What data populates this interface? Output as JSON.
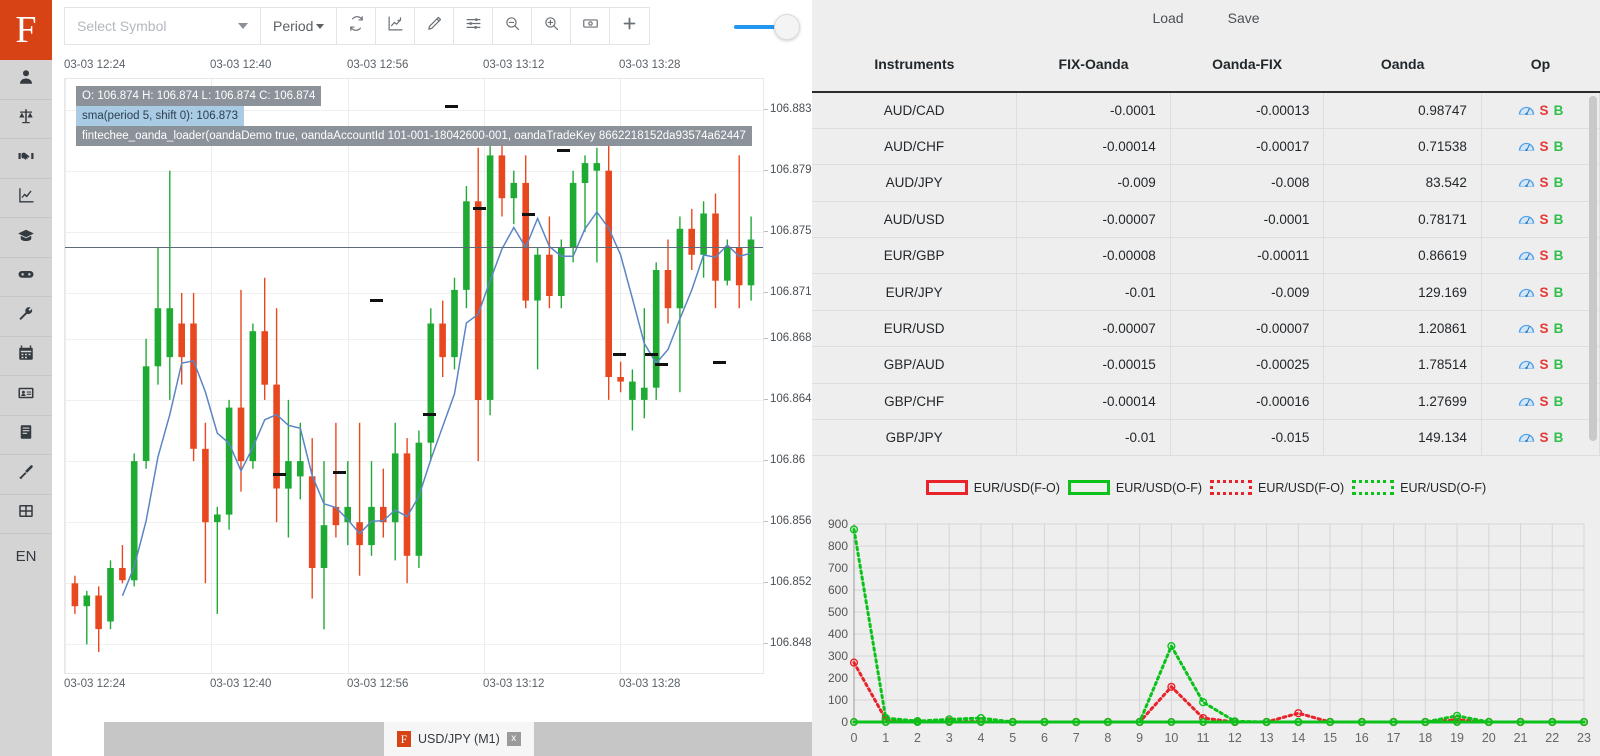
{
  "app": {
    "logo": "F",
    "language": "EN"
  },
  "sidebar": {
    "items": [
      {
        "name": "user-icon",
        "label": "Account"
      },
      {
        "name": "scales-icon",
        "label": "Balance"
      },
      {
        "name": "handshake-icon",
        "label": "Deals"
      },
      {
        "name": "chart-icon",
        "label": "Charts"
      },
      {
        "name": "graduation-cap-icon",
        "label": "Education"
      },
      {
        "name": "gamepad-icon",
        "label": "Simulator"
      },
      {
        "name": "wrench-icon",
        "label": "Tools"
      },
      {
        "name": "calendar-icon",
        "label": "Calendar"
      },
      {
        "name": "id-card-icon",
        "label": "Profile"
      },
      {
        "name": "book-icon",
        "label": "Journal"
      },
      {
        "name": "brush-icon",
        "label": "Theme"
      },
      {
        "name": "table-icon",
        "label": "Grid"
      }
    ]
  },
  "toolbar": {
    "symbol_placeholder": "Select Symbol",
    "symbol_value": "",
    "period_label": "Period",
    "buttons": [
      {
        "name": "refresh-icon",
        "label": "Refresh"
      },
      {
        "name": "line-chart-icon",
        "label": "Chart type"
      },
      {
        "name": "pencil-icon",
        "label": "Draw"
      },
      {
        "name": "sliders-icon",
        "label": "Indicators"
      },
      {
        "name": "zoom-out-icon",
        "label": "Zoom out"
      },
      {
        "name": "zoom-in-icon",
        "label": "Zoom in"
      },
      {
        "name": "banknote-icon",
        "label": "Trade"
      },
      {
        "name": "plus-icon",
        "label": "Add"
      }
    ],
    "toggle_state": "on"
  },
  "chart": {
    "info_ohlc": "O: 106.874 H: 106.874 L: 106.874 C: 106.874",
    "info_sma": "sma(period 5, shift 0): 106.873",
    "info_loader": "fintechee_oanda_loader(oandaDemo true, oandaAccountId 101-001-18042600-001, oandaTradeKey 8662218152da93574a62447",
    "time_labels": [
      "03-03 12:24",
      "03-03 12:40",
      "03-03 12:56",
      "03-03 13:12",
      "03-03 13:28"
    ],
    "price_labels": [
      "106.883",
      "106.879",
      "106.875",
      "106.871",
      "106.868",
      "106.864",
      "106.86",
      "106.856",
      "106.852",
      "106.848"
    ],
    "cursor_price": "106.874",
    "tab": {
      "symbol": "USD/JPY (M1)",
      "logo": "F",
      "close": "x"
    }
  },
  "right_panel": {
    "actions": {
      "load": "Load",
      "save": "Save"
    },
    "columns": [
      "Instruments",
      "FIX-Oanda",
      "Oanda-FIX",
      "Oanda",
      "Op"
    ],
    "rows": [
      {
        "instrument": "AUD/CAD",
        "fix_oanda": "-0.0001",
        "oanda_fix": "-0.00013",
        "oanda": "0.98747",
        "sell": "S",
        "buy": "B"
      },
      {
        "instrument": "AUD/CHF",
        "fix_oanda": "-0.00014",
        "oanda_fix": "-0.00017",
        "oanda": "0.71538",
        "sell": "S",
        "buy": "B"
      },
      {
        "instrument": "AUD/JPY",
        "fix_oanda": "-0.009",
        "oanda_fix": "-0.008",
        "oanda": "83.542",
        "sell": "S",
        "buy": "B"
      },
      {
        "instrument": "AUD/USD",
        "fix_oanda": "-0.00007",
        "oanda_fix": "-0.0001",
        "oanda": "0.78171",
        "sell": "S",
        "buy": "B"
      },
      {
        "instrument": "EUR/GBP",
        "fix_oanda": "-0.00008",
        "oanda_fix": "-0.00011",
        "oanda": "0.86619",
        "sell": "S",
        "buy": "B"
      },
      {
        "instrument": "EUR/JPY",
        "fix_oanda": "-0.01",
        "oanda_fix": "-0.009",
        "oanda": "129.169",
        "sell": "S",
        "buy": "B"
      },
      {
        "instrument": "EUR/USD",
        "fix_oanda": "-0.00007",
        "oanda_fix": "-0.00007",
        "oanda": "1.20861",
        "sell": "S",
        "buy": "B"
      },
      {
        "instrument": "GBP/AUD",
        "fix_oanda": "-0.00015",
        "oanda_fix": "-0.00025",
        "oanda": "1.78514",
        "sell": "S",
        "buy": "B"
      },
      {
        "instrument": "GBP/CHF",
        "fix_oanda": "-0.00014",
        "oanda_fix": "-0.00016",
        "oanda": "1.27699",
        "sell": "S",
        "buy": "B"
      },
      {
        "instrument": "GBP/JPY",
        "fix_oanda": "-0.01",
        "oanda_fix": "-0.015",
        "oanda": "149.134",
        "sell": "S",
        "buy": "B"
      }
    ]
  },
  "colors": {
    "brand": "#d84315",
    "up": "#1faa34",
    "down": "#e8481f",
    "sell": "#e53935",
    "buy": "#2fbf4a",
    "sma": "#5b85c4",
    "legend_red": "#e8232a",
    "legend_green": "#0ac21a"
  },
  "chart_data": [
    {
      "type": "line",
      "title": "",
      "name": "spread-history",
      "xlabel": "",
      "ylabel": "",
      "xlim": [
        0,
        23
      ],
      "ylim": [
        0,
        900
      ],
      "grid": true,
      "legend_position": "top-center",
      "xticks": [
        0,
        1,
        2,
        3,
        4,
        5,
        6,
        7,
        8,
        9,
        10,
        11,
        12,
        13,
        14,
        15,
        16,
        17,
        18,
        19,
        20,
        21,
        22,
        23
      ],
      "yticks": [
        0,
        100,
        200,
        300,
        400,
        500,
        600,
        700,
        800,
        900
      ],
      "series": [
        {
          "name": "EUR/USD(F-O)",
          "style": "solid",
          "color": "#e8232a",
          "values": [
            0,
            0,
            0,
            0,
            0,
            0,
            0,
            0,
            0,
            0,
            0,
            0,
            0,
            0,
            0,
            0,
            0,
            0,
            0,
            0,
            0,
            0,
            0,
            0
          ]
        },
        {
          "name": "EUR/USD(O-F)",
          "style": "solid",
          "color": "#0ac21a",
          "values": [
            0,
            0,
            0,
            0,
            0,
            0,
            0,
            0,
            0,
            0,
            0,
            0,
            0,
            0,
            0,
            0,
            0,
            0,
            0,
            0,
            0,
            0,
            0,
            0
          ]
        },
        {
          "name": "EUR/USD(F-O)",
          "style": "dotted",
          "color": "#e8232a",
          "values": [
            270,
            12,
            2,
            3,
            2,
            0,
            0,
            0,
            0,
            0,
            160,
            18,
            0,
            0,
            40,
            0,
            0,
            0,
            0,
            10,
            0,
            0,
            0,
            0
          ]
        },
        {
          "name": "EUR/USD(O-F)",
          "style": "dotted",
          "color": "#0ac21a",
          "values": [
            875,
            18,
            4,
            12,
            18,
            0,
            0,
            0,
            0,
            0,
            345,
            90,
            3,
            0,
            0,
            0,
            0,
            0,
            0,
            28,
            0,
            0,
            0,
            0
          ]
        }
      ]
    },
    {
      "type": "candlestick",
      "name": "usdjpy-m1",
      "title": "USD/JPY (M1)",
      "ylim": [
        106.846,
        106.885
      ],
      "yticks": [
        106.848,
        106.852,
        106.856,
        106.86,
        106.864,
        106.868,
        106.871,
        106.875,
        106.879,
        106.883
      ],
      "xticks": [
        "03-03 12:24",
        "03-03 12:40",
        "03-03 12:56",
        "03-03 13:12",
        "03-03 13:28"
      ],
      "overlay": "sma(period 5, shift 0)",
      "last_price": 106.874
    }
  ]
}
